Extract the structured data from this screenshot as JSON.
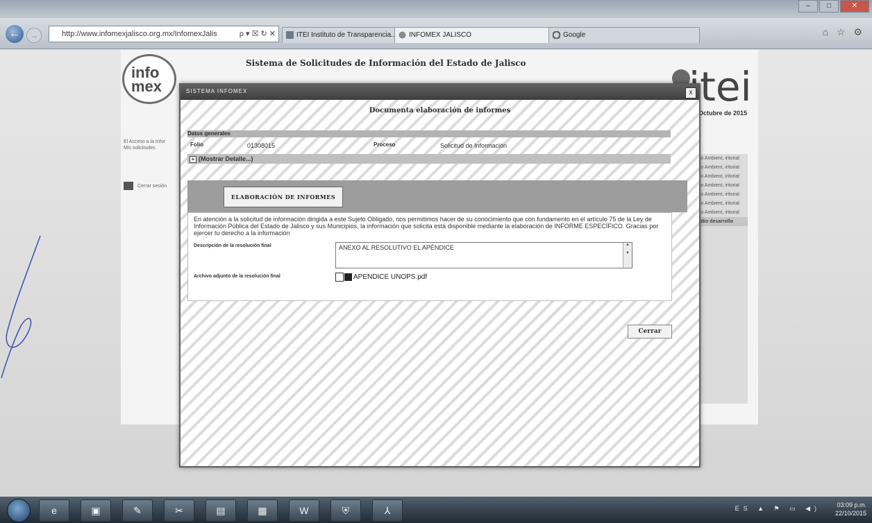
{
  "browser": {
    "address_url": "http://www.infomexjalisco.org.mx/InfomexJalis",
    "address_controls": "ρ ▾ ☒ ↻ ✕",
    "tabs": [
      {
        "label": "ITEI Instituto de Transparencia...",
        "active": false
      },
      {
        "label": "INFOMEX JALISCO",
        "active": true
      },
      {
        "label": "Google",
        "active": false
      }
    ],
    "topright_icons": "⌂ ☆ ⚙"
  },
  "page": {
    "title": "Sistema de Solicitudes de Información del Estado de Jalisco",
    "logo_info": "info",
    "logo_mex": "mex",
    "logo_itei": "itei",
    "date": "Octubre de 2015",
    "left_links": [
      "El Acceso a la Infor",
      "Mis solicitudes"
    ],
    "cerrar_sesion": "Cerrar sesión",
    "right_panel_items": [
      "edio Ambient, iritorial",
      "edio Ambient, iritorial",
      "edio Ambient, iritorial",
      "edio Ambient, iritorial",
      "edio Ambient, iritorial",
      "edio Ambient, iritorial",
      "edio Ambient, iritorial",
      "Medio desarrollo"
    ]
  },
  "modal": {
    "header_title": "SISTEMA INFOMEX",
    "close_glyph": "x",
    "doc_title": "Documenta elaboración de informes",
    "datos_generales": "Datos generales",
    "folio_label": "Folio",
    "folio_value": "01308015",
    "proceso_label": "Proceso",
    "proceso_value": "Solicitud de Información",
    "mostrar_detalle": "(Mostrar Detalle...)",
    "tab_label": "ELABORACIÓN DE INFORMES",
    "intro_text": "En atención a la solicitud de información dirigida a este Sujeto Obligado, nos permitimos hacer de su conocimiento que con fundamento en el artículo 75 de la Ley de Información Pública del Estado de Jalisco y sus Municipios, la información que solicita está disponible mediante la elaboración de INFORME ESPECÍFICO. Gracias por ejercer tu derecho a la información",
    "descripcion_label": "Descripción de la resolución final",
    "descripcion_value": "ANEXO AL RESOLUTIVO EL APÉNDICE",
    "archivo_label": "Archivo adjunto de la resolución final",
    "archivo_name": "APENDICE UNOPS.pdf",
    "cerrar_label": "Cerrar"
  },
  "taskbar": {
    "items": [
      "e",
      "▣",
      "✎",
      "✂",
      "▤",
      "▦",
      "W",
      "⛨",
      "⅄"
    ],
    "lang": "ES",
    "tray_icons": "▲ ⚑ ▭ ◀)",
    "time": "03:09 p.m.",
    "date": "22/10/2015"
  },
  "colors": {
    "modal_header": "#4a4a4a",
    "tab_strip": "#9d9d9d",
    "taskbar": "#2b3743"
  }
}
